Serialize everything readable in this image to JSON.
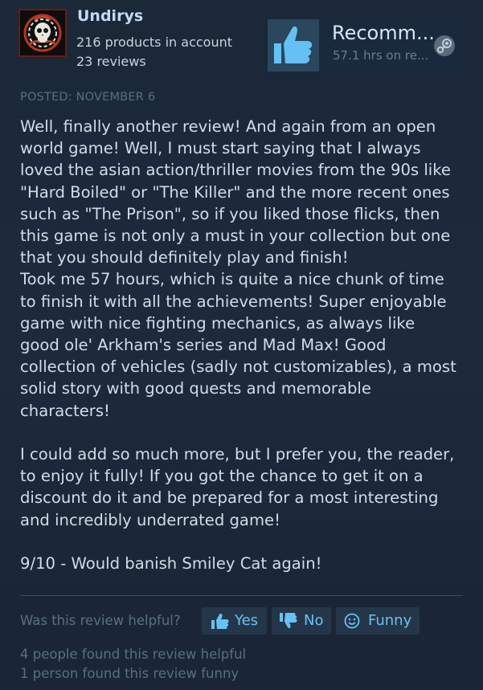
{
  "author": {
    "name": "Undirys",
    "products": "216 products in account",
    "reviews": "23 reviews",
    "avatar_icon": "skull-emblem-icon"
  },
  "recommendation": {
    "title": "Recomm...",
    "hours": "57.1 hrs on re...",
    "thumb_icon": "thumbs-up-icon",
    "platform_icon": "steam-logo-icon"
  },
  "review": {
    "posted": "POSTED: NOVEMBER 6",
    "paragraphs": [
      "Well, finally another review! And again from an open",
      "world game! Well, I must start saying that I always",
      "loved the asian action/thriller movies from the 90s like",
      "\"Hard Boiled\" or \"The Killer\" and the more recent ones",
      "such as \"The Prison\", so if you liked those flicks, then",
      "this game is not only a must in your collection but one",
      "that you should definitely play and finish!",
      "Took me 57 hours, which is quite a nice chunk of time",
      "to finish it with all the achievements! Super enjoyable",
      "game with nice fighting mechanics, as always like",
      "good ole' Arkham's series and Mad Max! Good",
      "collection of vehicles (sadly not customizables), a most",
      "solid story with good quests and memorable",
      "characters!",
      "",
      "I could add so much more, but I prefer you, the reader,",
      "to enjoy it fully! If you got the chance to get it on a",
      "discount do it and be prepared for a most interesting",
      "and incredibly underrated game!",
      "",
      "9/10 - Would banish Smiley Cat again!"
    ]
  },
  "helpful": {
    "question": "Was this review helpful?",
    "yes_label": "Yes",
    "no_label": "No",
    "funny_label": "Funny",
    "helpful_count_text": "4 people found this review helpful",
    "funny_count_text": "1 person found this review funny"
  },
  "colors": {
    "background": "#1b2838",
    "accent_blue": "#67c1f5",
    "author_name": "#c1dbf4",
    "muted": "#56707f"
  }
}
